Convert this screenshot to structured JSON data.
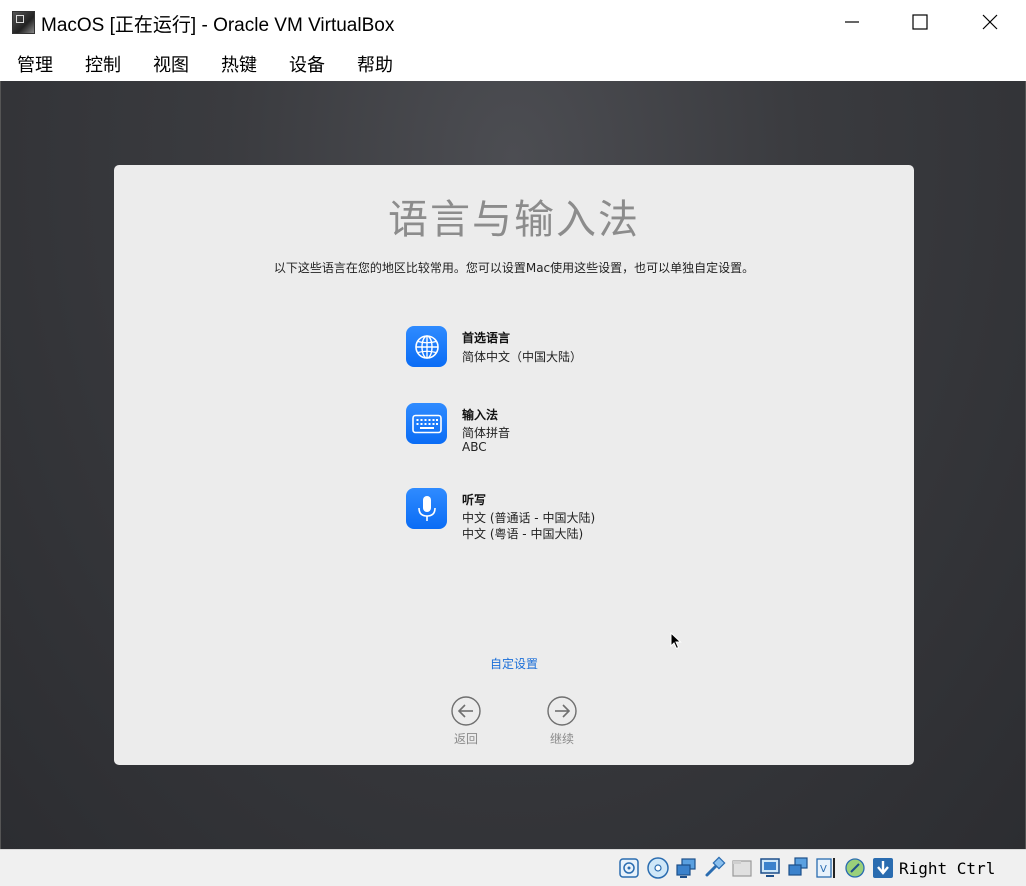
{
  "window": {
    "title": "MacOS [正在运行] - Oracle VM VirtualBox",
    "app_icon": "virtualbox-vm-icon",
    "controls": [
      "minimize-icon",
      "maximize-icon",
      "close-icon"
    ]
  },
  "menubar": {
    "items": [
      "管理",
      "控制",
      "视图",
      "热键",
      "设备",
      "帮助"
    ]
  },
  "setup": {
    "title": "语言与输入法",
    "description": "以下这些语言在您的地区比较常用。您可以设置Mac使用这些设置，也可以单独自定设置。",
    "items": [
      {
        "icon": "globe-icon",
        "heading": "首选语言",
        "lines": [
          "简体中文（中国大陆）"
        ]
      },
      {
        "icon": "keyboard-icon",
        "heading": "输入法",
        "lines": [
          "简体拼音",
          "ABC"
        ]
      },
      {
        "icon": "microphone-icon",
        "heading": "听写",
        "lines": [
          "中文 (普通话 - 中国大陆)",
          "中文 (粤语 - 中国大陆)"
        ]
      }
    ],
    "customize_label": "自定设置",
    "back_label": "返回",
    "continue_label": "继续"
  },
  "statusbar": {
    "icons": [
      "hard-disk-icon",
      "optical-drive-icon",
      "network-icon",
      "usb-icon",
      "shared-folder-icon",
      "display-icon",
      "network-adapters-icon",
      "video-capture-icon",
      "mouse-integration-icon",
      "arrow-down-icon"
    ],
    "host_key": "Right Ctrl"
  },
  "colors": {
    "accent": "#0a6cf5",
    "link": "#1a6ed8",
    "panel_bg": "#ececec",
    "desktop_bg": "#3a3b3f"
  }
}
